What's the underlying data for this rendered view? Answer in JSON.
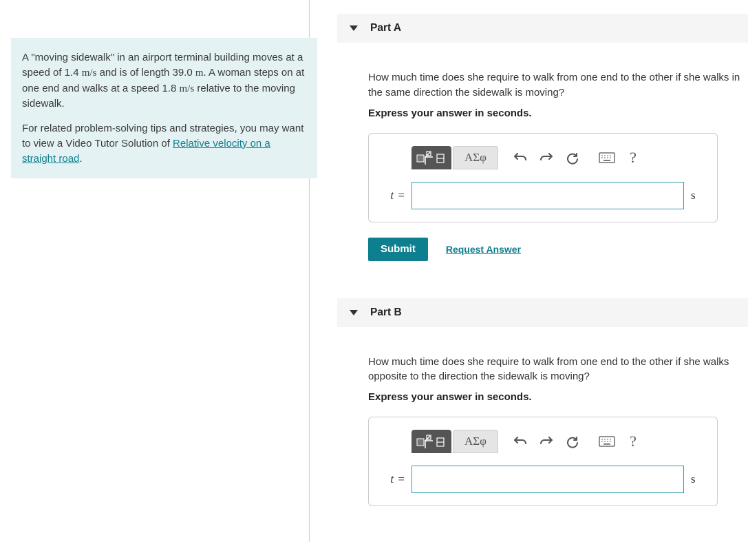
{
  "left": {
    "p1_a": "A \"moving sidewalk\" in an airport terminal building moves at a speed of 1.4 ",
    "unit1": "m/s",
    "p1_b": " and is of length 39.0 ",
    "unit2": "m",
    "p1_c": ". A woman steps on at one end and walks at a speed 1.8 ",
    "unit3": "m/s",
    "p1_d": " relative to the moving sidewalk.",
    "p2_a": "For related problem-solving tips and strategies, you may want to view a Video Tutor Solution of ",
    "link": "Relative velocity on a straight road",
    "p2_b": "."
  },
  "parts": {
    "a": {
      "title": "Part A",
      "question": "How much time does she require to walk from one end to the other if she walks in the same direction the sidewalk is moving?",
      "instr": "Express your answer in seconds.",
      "var": "t",
      "eq": "=",
      "unit": "s",
      "value": ""
    },
    "b": {
      "title": "Part B",
      "question": "How much time does she require to walk from one end to the other if she walks opposite to the direction the sidewalk is moving?",
      "instr": "Express your answer in seconds.",
      "var": "t",
      "eq": "=",
      "unit": "s",
      "value": ""
    }
  },
  "toolbar": {
    "symbols_label": "ΑΣφ",
    "help_label": "?"
  },
  "actions": {
    "submit": "Submit",
    "request": "Request Answer"
  }
}
